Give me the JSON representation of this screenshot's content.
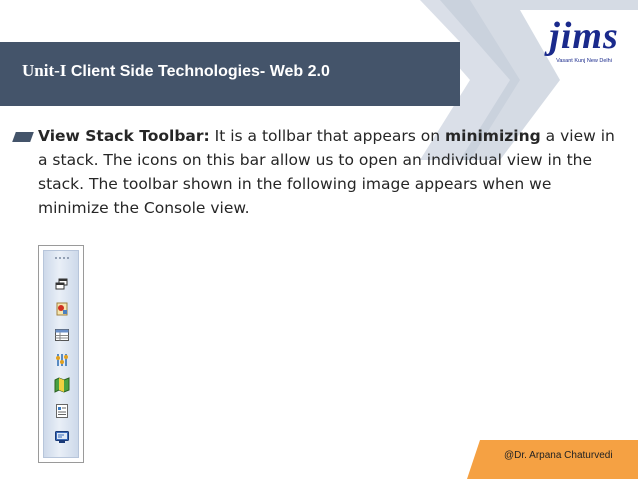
{
  "slide": {
    "title_unit": "Unit-I",
    "title_rest": " Client Side Technologies- Web 2.0",
    "logo_word": "jims",
    "logo_sub": "Vasant Kunj New Delhi"
  },
  "bullet": {
    "bold_lead": "View Stack Toolbar:",
    "text1": " It is a tollbar that appears on ",
    "bold_mid": "minimizing",
    "text2": " a view in a stack. The icons on this bar allow us to open an individual view in the stack. The toolbar shown in the following image appears when we minimize the Console view."
  },
  "toolbar": {
    "icons": [
      "restore-icon",
      "project-explorer-icon",
      "table-outline-icon",
      "debug-icon",
      "package-map-icon",
      "properties-icon",
      "console-icon"
    ]
  },
  "footer": {
    "author": "@Dr. Arpana Chaturvedi"
  },
  "colors": {
    "title_bar": "#44546a",
    "accent": "#f5a143",
    "logo": "#1a2a8c"
  }
}
